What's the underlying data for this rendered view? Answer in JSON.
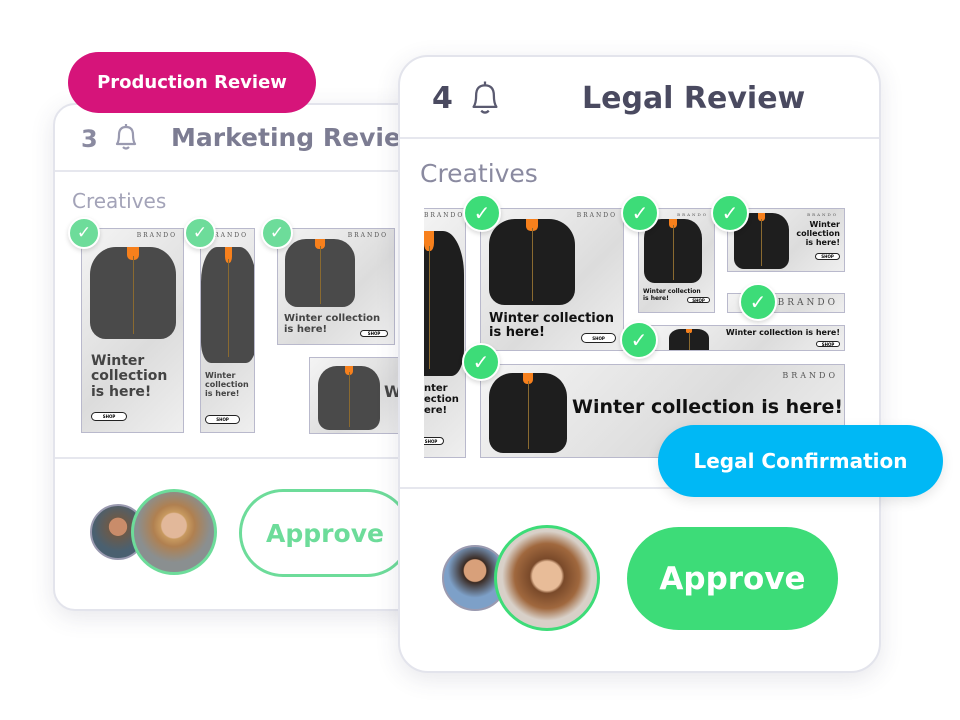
{
  "marketing_card": {
    "count": "3",
    "title": "Marketing Review",
    "section": "Creatives",
    "approve": "Approve"
  },
  "production_badge": "Production Review",
  "legal_card": {
    "count": "4",
    "title": "Legal Review",
    "section": "Creatives",
    "approve": "Approve"
  },
  "legal_badge": "Legal Confirmation",
  "creative": {
    "brand": "BRANDO",
    "headline": "Winter collection is here!",
    "h1": "Winter",
    "h2": "collection",
    "h3": "is here!",
    "h_a": "Winter collection",
    "cta": "SHOP",
    "partial1": "nter",
    "partial2": "ection",
    "partial3": "ere!",
    "partialW": "W"
  },
  "colors": {
    "magenta": "#d6147a",
    "cyan": "#00b8f5",
    "green": "#3ddc78",
    "green_light": "#6ddc9a"
  },
  "icons": {
    "bell": "bell-icon",
    "check": "check-icon"
  }
}
